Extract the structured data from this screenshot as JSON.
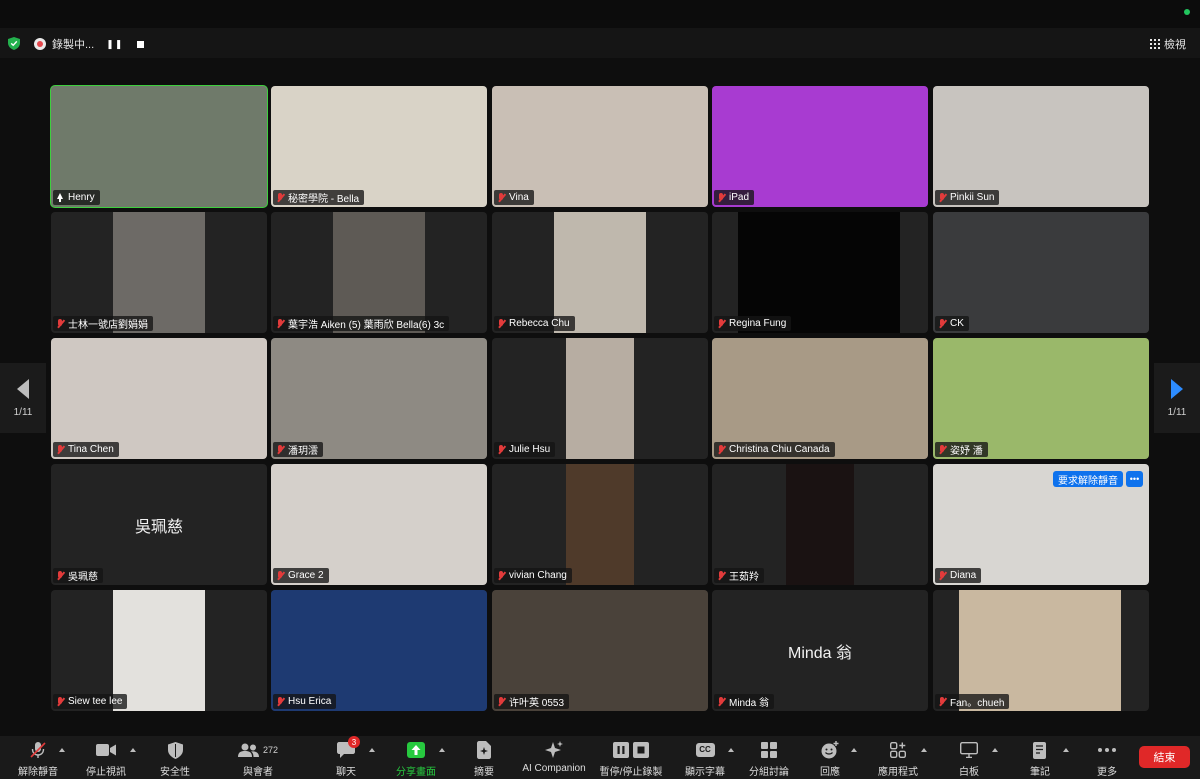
{
  "topbar": {
    "recording_label": "錄製中...",
    "pause_glyph": "❚❚",
    "view_label": "檢視",
    "security_icon": "shield-check-icon"
  },
  "pagination": {
    "left": "1/11",
    "right": "1/11"
  },
  "participants": [
    {
      "name": "Henry",
      "muted": false,
      "active": true,
      "bg": "#6f7a6a"
    },
    {
      "name": "秘密學院 - Bella",
      "muted": true,
      "bg": "#d9d3c7"
    },
    {
      "name": "Vina",
      "muted": true,
      "bg": "#c9bfb5"
    },
    {
      "name": "iPad",
      "muted": true,
      "bg": "#a83bd1"
    },
    {
      "name": "Pinkii Sun",
      "muted": true,
      "bg": "#c8c4bf"
    },
    {
      "name": "士林一號店劉娟娟",
      "muted": true,
      "bg": "#6d6a66"
    },
    {
      "name": "葉宇浩 Aiken (5) 葉雨欣 Bella(6) 3c",
      "muted": true,
      "bg": "#5e5a55"
    },
    {
      "name": "Rebecca Chu",
      "muted": true,
      "bg": "#bfb8ad"
    },
    {
      "name": "Regina Fung",
      "muted": true,
      "bg": "#050505"
    },
    {
      "name": "CK",
      "muted": true,
      "bg": "#3a3b3d"
    },
    {
      "name": "Tina Chen",
      "muted": true,
      "bg": "#cfc8c2"
    },
    {
      "name": "潘玥澐",
      "muted": true,
      "bg": "#8e8a83"
    },
    {
      "name": "Julie Hsu",
      "muted": true,
      "bg": "#b7ada2"
    },
    {
      "name": "Christina Chiu Canada",
      "muted": true,
      "bg": "#a89a86"
    },
    {
      "name": "姿妤 潘",
      "muted": true,
      "bg": "#9ab86a"
    },
    {
      "name": "吳珮慈",
      "muted": true,
      "center": "吳珮慈",
      "bg": "#242424"
    },
    {
      "name": "Grace 2",
      "muted": true,
      "bg": "#d5d0cb"
    },
    {
      "name": "vivian Chang",
      "muted": true,
      "bg": "#4f3a2a"
    },
    {
      "name": "王茹羚",
      "muted": true,
      "bg": "#1a1212"
    },
    {
      "name": "Diana",
      "muted": true,
      "bg": "#d8d6d2",
      "request_unmute": "要求解除靜音",
      "more": "•••"
    },
    {
      "name": "Siew tee lee",
      "muted": true,
      "bg": "#e3e1dd"
    },
    {
      "name": "Hsu Erica",
      "muted": true,
      "bg": "#1e3a72"
    },
    {
      "name": "许叶英 0553",
      "muted": true,
      "bg": "#4a423a"
    },
    {
      "name": "Minda 翁",
      "muted": true,
      "center": "Minda 翁",
      "bg": "#242424"
    },
    {
      "name": "Fan。chueh",
      "muted": true,
      "bg": "#c9b8a0"
    }
  ],
  "toolbar": {
    "unmute": "解除靜音",
    "stop_video": "停止視訊",
    "security": "安全性",
    "participants": "與會者",
    "participants_count": "272",
    "chat": "聊天",
    "chat_badge": "3",
    "share": "分享畫面",
    "summary": "摘要",
    "ai": "AI Companion",
    "record": "暫停/停止錄製",
    "captions": "顯示字幕",
    "captions_glyph": "CC",
    "breakout": "分組討論",
    "reactions": "回應",
    "apps": "應用程式",
    "whiteboard": "白板",
    "notes": "筆記",
    "more": "更多",
    "end": "結束"
  },
  "colors": {
    "active_speaker": "#3ecf3e",
    "share_green": "#27c93f",
    "end_red": "#e02828",
    "badge_blue": "#0e72ed",
    "muted_red": "#e23b3b"
  }
}
